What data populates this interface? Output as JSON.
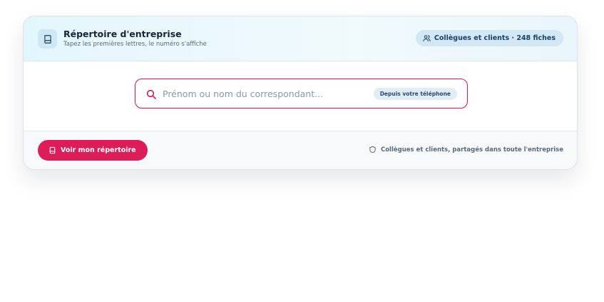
{
  "header": {
    "title": "Répertoire d'entreprise",
    "subtitle": "Tapez les premières lettres, le numéro s'affiche",
    "icon": "book-icon",
    "badge": {
      "icon": "users-icon",
      "label": "Collègues et clients · 248 fiches"
    }
  },
  "search": {
    "icon": "search-icon",
    "placeholder": "Prénom ou nom du correspondant...",
    "value": "",
    "chip": "Depuis votre téléphone"
  },
  "footer": {
    "button": {
      "icon": "book-icon",
      "label": "Voir mon répertoire"
    },
    "note": {
      "icon": "shield-icon",
      "label": "Collègues et clients, partagés dans toute l'entreprise"
    }
  },
  "colors": {
    "accent": "#dc1d59",
    "header_bg": "#e4f6fd",
    "badge_bg": "#d2e8f5",
    "text_primary": "#17243a"
  }
}
